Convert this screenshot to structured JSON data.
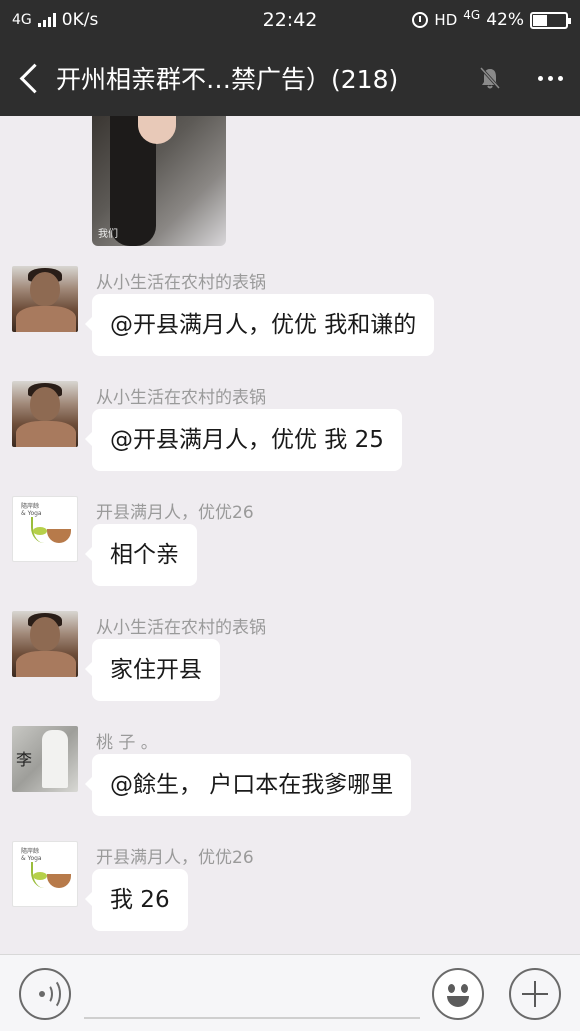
{
  "status_bar": {
    "network": "4G",
    "speed": "0K/s",
    "time": "22:42",
    "hd": "HD",
    "network2": "4G",
    "battery_percent": "42%",
    "battery_level": 0.42
  },
  "header": {
    "title": "开州相亲群不…禁广告）(218)",
    "icons": [
      "back-arrow-icon",
      "bell-muted-icon",
      "more-icon"
    ]
  },
  "messages": [
    {
      "kind": "image",
      "avatar": "photo",
      "sticker_text": "我们"
    },
    {
      "sender": "从小生活在农村的表锅",
      "text": "@开县满月人，优优  我和谦的",
      "avatar": "man"
    },
    {
      "sender": "从小生活在农村的表锅",
      "text": "@开县满月人，优优  我 25",
      "avatar": "man"
    },
    {
      "sender": "开县满月人，优优26",
      "text": "相个亲",
      "avatar": "bowl"
    },
    {
      "sender": "从小生活在农村的表锅",
      "text": "家住开县",
      "avatar": "man"
    },
    {
      "sender": "桃 子 。",
      "text": "@餘生，  户口本在我爹哪里",
      "avatar": "peach"
    },
    {
      "sender": "开县满月人，优优26",
      "text": "我 26",
      "avatar": "bowl"
    }
  ],
  "avatar_labels": {
    "bowl_top": "隨岸餘",
    "bowl_sub": "& Yoga",
    "peach_char": "李"
  },
  "input_bar": {
    "placeholder": "",
    "icons": [
      "voice-icon",
      "emoji-icon",
      "plus-icon"
    ]
  },
  "colors": {
    "header_bg": "#2e2e2e",
    "chat_bg": "#efecf0",
    "bubble_bg": "#ffffff",
    "sender_text": "#9a9a9a"
  }
}
